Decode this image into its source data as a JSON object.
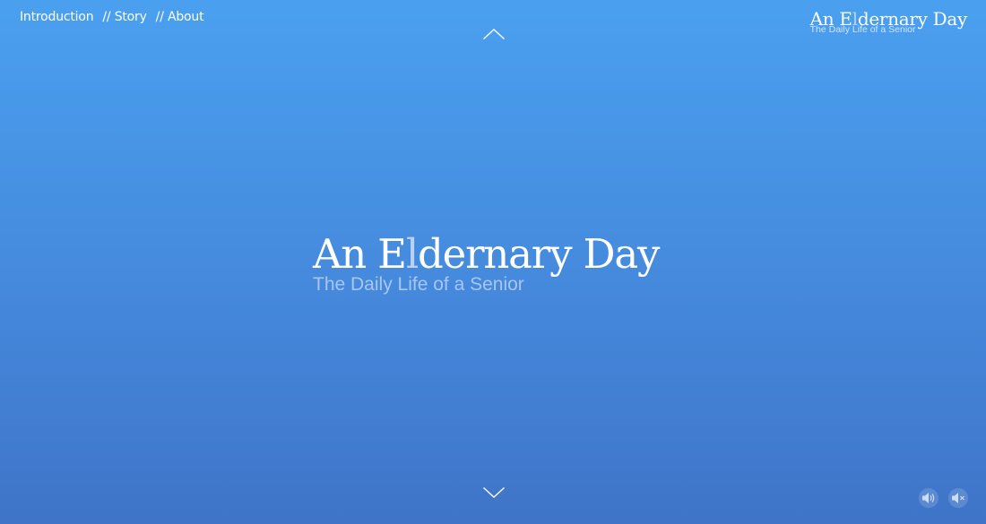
{
  "nav": {
    "items": [
      {
        "label": "Introduction",
        "separator": ""
      },
      {
        "label": "Story",
        "separator": "// "
      },
      {
        "label": "About",
        "separator": "// "
      }
    ]
  },
  "logo": {
    "title_part1": "An E",
    "title_highlight": "l",
    "title_part2": "dernary Day",
    "subtitle": "The Daily Life of a Senior"
  },
  "hero": {
    "title_part1": "An E",
    "title_highlight": "l",
    "title_part2": "dernary Day",
    "subtitle": "The Daily Life of a Senior"
  },
  "icons": {
    "scroll_up": "chevron-up-icon",
    "scroll_down": "chevron-down-icon",
    "sound_on": "speaker-icon",
    "sound_off": "speaker-mute-icon"
  },
  "colors": {
    "background_top": "#4aa0ef",
    "background_bottom": "#3f74c8",
    "text": "#ffffff",
    "subtitle": "#a9c6ef",
    "highlight_letter": "#b9d2f2"
  }
}
